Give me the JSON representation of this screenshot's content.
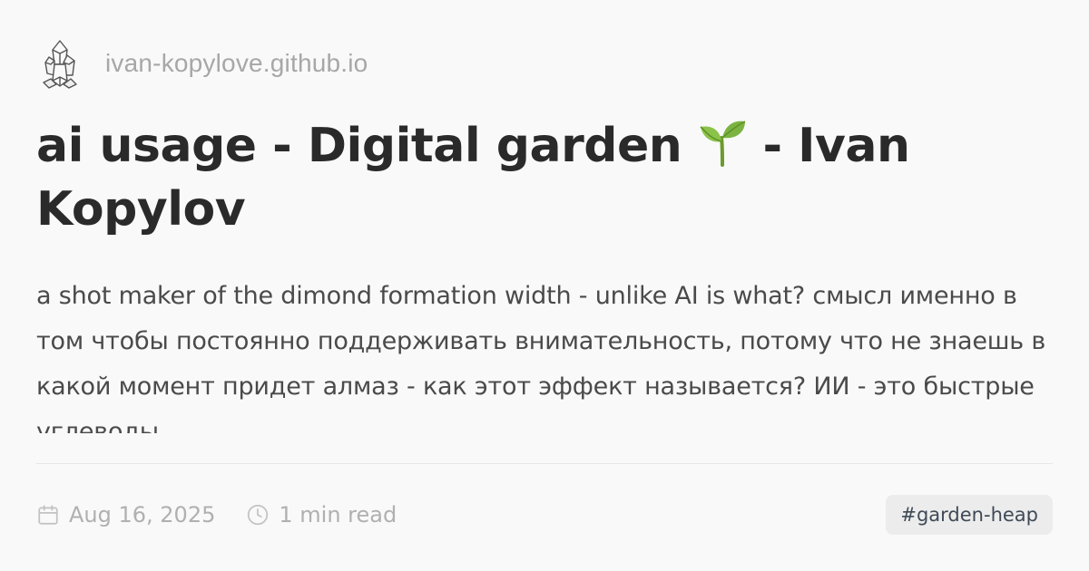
{
  "site": {
    "domain": "ivan-kopylove.github.io",
    "logo_icon": "crystal-icon"
  },
  "post": {
    "title_before_icon": "ai usage - Digital garden ",
    "title_icon": "sprout-icon",
    "title_after_icon": " - Ivan Kopylov",
    "description": "a shot maker of the dimond formation width - unlike AI is what? смысл именно в том чтобы постоянно поддерживать внимательность, потому что не знаешь в какой момент придет алмаз - как этот эффект называется? ИИ - это быстрые углеводы"
  },
  "meta": {
    "date": "Aug 16, 2025",
    "date_icon": "calendar-icon",
    "read_time": "1 min read",
    "read_time_icon": "clock-icon",
    "tag": "#garden-heap"
  },
  "colors": {
    "background": "#f9f9f9",
    "title": "#2a2a2a",
    "muted": "#a7a7a7",
    "tag_bg": "#ececec",
    "sprout": "#7cb342"
  }
}
